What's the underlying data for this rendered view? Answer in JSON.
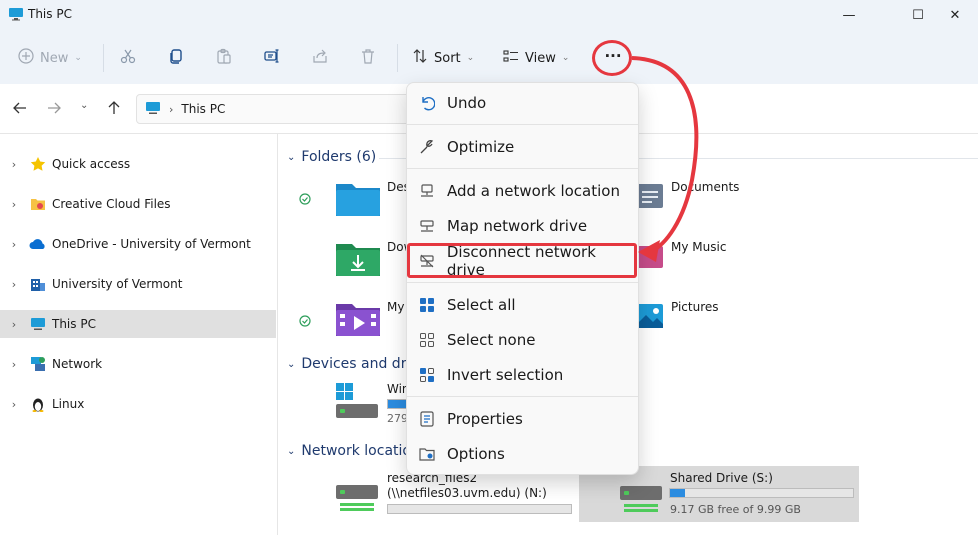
{
  "window": {
    "title": "This PC",
    "minimize_glyph": "—",
    "maximize_glyph": "☐",
    "close_glyph": "✕"
  },
  "toolbar": {
    "new_label": "New",
    "sort_label": "Sort",
    "view_label": "View",
    "more_glyph": "···"
  },
  "address": {
    "path": "This PC"
  },
  "sidebar": {
    "items": [
      {
        "label": "Quick access",
        "icon": "star-icon"
      },
      {
        "label": "Creative Cloud Files",
        "icon": "creative-cloud-folder-icon"
      },
      {
        "label": "OneDrive - University of Vermont",
        "icon": "cloud-icon"
      },
      {
        "label": "University of Vermont",
        "icon": "building-icon"
      },
      {
        "label": "This PC",
        "icon": "monitor-icon"
      },
      {
        "label": "Network",
        "icon": "network-icon"
      },
      {
        "label": "Linux",
        "icon": "penguin-icon"
      }
    ]
  },
  "main": {
    "folders_header": "Folders (6)",
    "folders": [
      {
        "name": "Desk",
        "icon": "desktop-folder-icon"
      },
      {
        "name": "Documents",
        "icon": "documents-folder-icon"
      },
      {
        "name": "Dow",
        "icon": "downloads-folder-icon"
      },
      {
        "name": "My Music",
        "icon": "music-folder-icon"
      },
      {
        "name": "My",
        "icon": "videos-folder-icon"
      },
      {
        "name": "Pictures",
        "icon": "pictures-folder-icon"
      }
    ],
    "devices_header": "Devices and driv",
    "drive_c": {
      "name": "Win",
      "free": "279",
      "used_fraction": 0.45
    },
    "network_header": "Network location",
    "net_drive_n": {
      "name_line1": "research_files2",
      "name_line2": "(\\\\netfiles03.uvm.edu) (N:)",
      "used_fraction": 0
    },
    "net_drive_s": {
      "name": "Shared Drive (S:)",
      "free": "9.17 GB free of 9.99 GB",
      "used_fraction": 0.08
    }
  },
  "menu": {
    "items": [
      {
        "label": "Undo",
        "icon": "undo-icon"
      },
      {
        "label": "Optimize",
        "icon": "wrench-icon"
      },
      {
        "label": "Add a network location",
        "icon": "add-network-location-icon"
      },
      {
        "label": "Map network drive",
        "icon": "map-network-drive-icon"
      },
      {
        "label": "Disconnect network drive",
        "icon": "disconnect-network-drive-icon"
      },
      {
        "label": "Select all",
        "icon": "select-all-icon"
      },
      {
        "label": "Select none",
        "icon": "select-none-icon"
      },
      {
        "label": "Invert selection",
        "icon": "invert-selection-icon"
      },
      {
        "label": "Properties",
        "icon": "properties-icon"
      },
      {
        "label": "Options",
        "icon": "options-icon"
      }
    ]
  },
  "colors": {
    "accent": "#2b8ce0",
    "annotation": "#e5373f",
    "selected": "#e0e0e0",
    "titlebar": "#eef3f9"
  }
}
